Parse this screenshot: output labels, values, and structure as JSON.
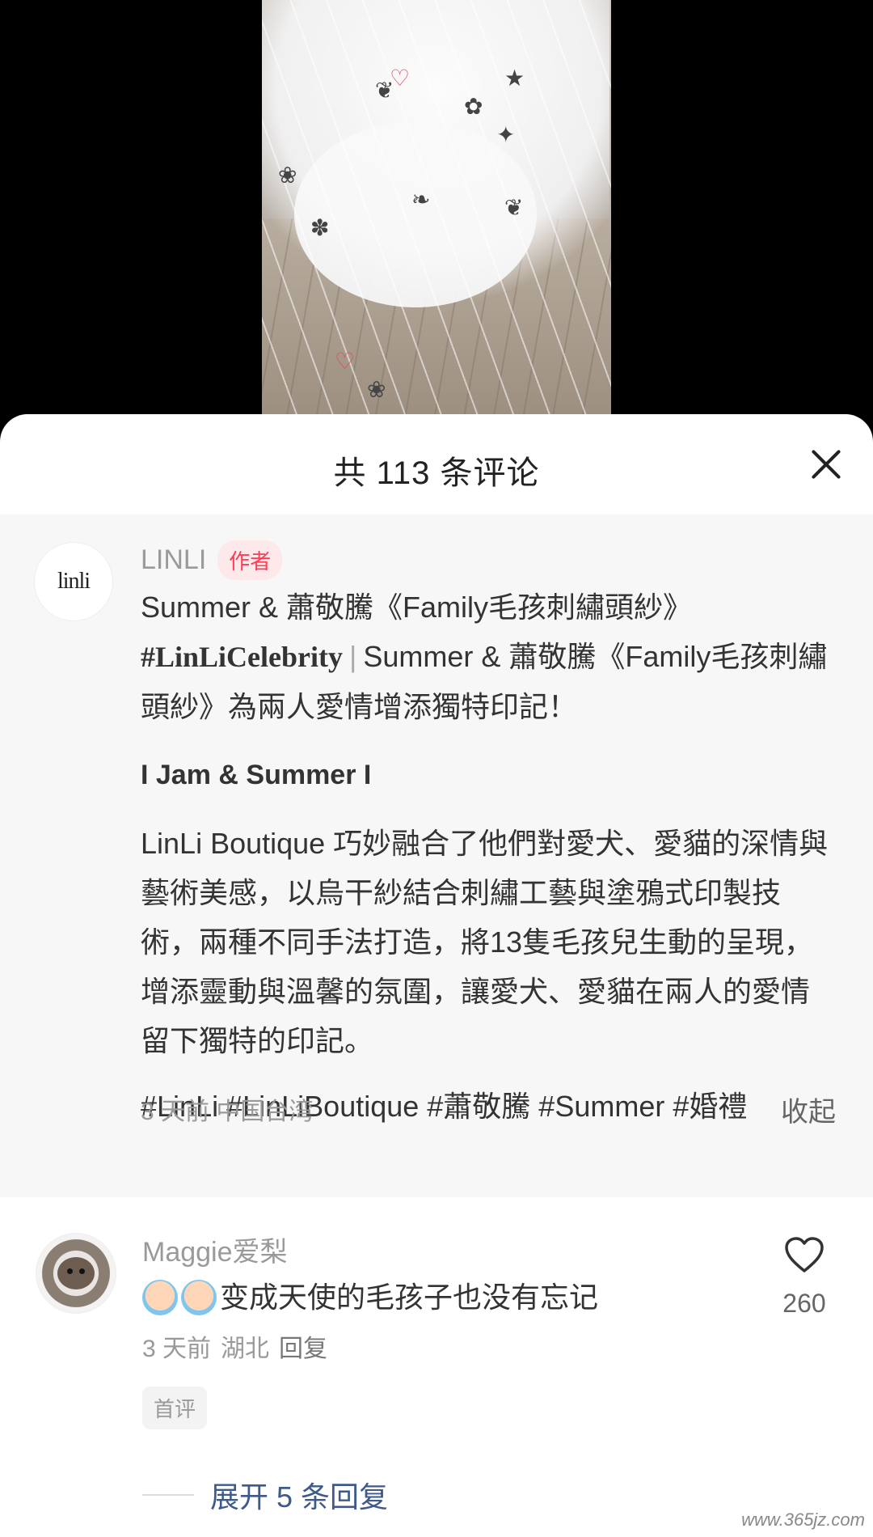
{
  "sheet": {
    "title": "共 113 条评论"
  },
  "author_comment": {
    "avatar_text": "linli",
    "name": "LINLI",
    "tag": "作者",
    "line1": "Summer & 蕭敬騰《Family毛孩刺繡頭紗》",
    "hashtag": "#LinLiCelebrity",
    "line2": "Summer & 蕭敬騰《Family毛孩刺繡頭紗》為兩人愛情增添獨特印記！",
    "section_heading": "I Jam & Summer I",
    "body": "LinLi Boutique 巧妙融合了他們對愛犬、愛貓的深情與藝術美感，以烏干紗結合刺繡工藝與塗鴉式印製技術，兩種不同手法打造，將13隻毛孩兒生動的呈現，增添靈動與溫馨的氛圍，讓愛犬、愛貓在兩人的愛情留下獨特的印記。",
    "tags": "#LinLi #LinLiBoutique #蕭敬騰 #Summer #婚禮",
    "time": "3 天前",
    "location": "中国台湾",
    "collapse_label": "收起"
  },
  "reply_comment": {
    "name": "Maggie爱梨",
    "text": "变成天使的毛孩子也没有忘记",
    "time": "3 天前",
    "location": "湖北",
    "reply_label": "回复",
    "badge": "首评",
    "like_count": "260",
    "expand_label": "展开 5 条回复"
  },
  "watermark": "www.365jz.com",
  "colors": {
    "author_tag_text": "#ff3b55",
    "author_tag_bg": "#fde8ea",
    "expand_link": "#3e5a8a",
    "author_block_bg": "#f7f7f7"
  }
}
